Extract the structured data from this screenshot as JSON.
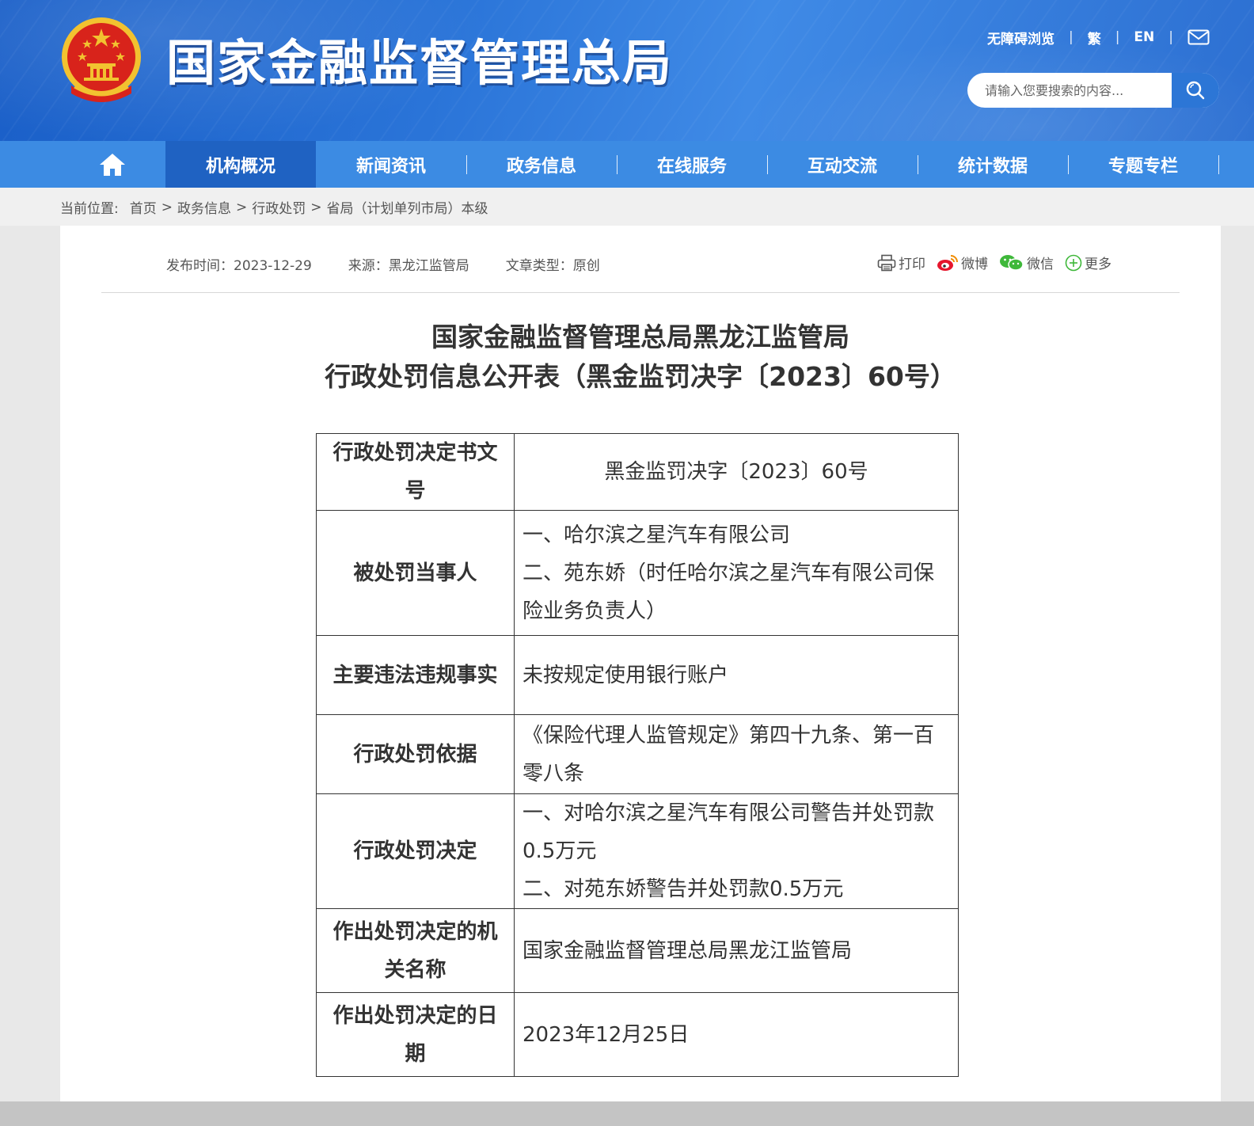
{
  "header": {
    "site_title": "国家金融监督管理总局",
    "top_links": {
      "accessibility": "无障碍浏览",
      "traditional": "繁",
      "english": "EN"
    },
    "search": {
      "placeholder": "请输入您要搜索的内容..."
    }
  },
  "nav": {
    "items": [
      {
        "label": "机构概况"
      },
      {
        "label": "新闻资讯"
      },
      {
        "label": "政务信息"
      },
      {
        "label": "在线服务"
      },
      {
        "label": "互动交流"
      },
      {
        "label": "统计数据"
      },
      {
        "label": "专题专栏"
      }
    ]
  },
  "breadcrumb": {
    "label": "当前位置:",
    "items": [
      "首页",
      "政务信息",
      "行政处罚",
      "省局（计划单列市局）本级"
    ]
  },
  "article": {
    "publish_time": "发布时间：2023-12-29",
    "source": "来源：黑龙江监管局",
    "type": "文章类型：原创",
    "share": {
      "print": "打印",
      "weibo": "微博",
      "wechat": "微信",
      "more": "更多"
    },
    "title_line1": "国家金融监督管理总局黑龙江监管局",
    "title_line2": "行政处罚信息公开表（黑金监罚决字〔2023〕60号）"
  },
  "table": {
    "rows": [
      {
        "key": "行政处罚决定书文号",
        "values": [
          "黑金监罚决字〔2023〕60号"
        ]
      },
      {
        "key": "被处罚当事人",
        "values": [
          "一、哈尔滨之星汽车有限公司",
          "二、苑东娇（时任哈尔滨之星汽车有限公司保险业务负责人）"
        ]
      },
      {
        "key": "主要违法违规事实",
        "values": [
          "未按规定使用银行账户"
        ]
      },
      {
        "key": "行政处罚依据",
        "values": [
          "《保险代理人监管规定》第四十九条、第一百零八条"
        ]
      },
      {
        "key": "行政处罚决定",
        "values": [
          "一、对哈尔滨之星汽车有限公司警告并处罚款0.5万元",
          "二、对苑东娇警告并处罚款0.5万元"
        ]
      },
      {
        "key": "作出处罚决定的机关名称",
        "values": [
          "国家金融监督管理总局黑龙江监管局"
        ]
      },
      {
        "key": "作出处罚决定的日期",
        "values": [
          "2023年12月25日"
        ]
      }
    ]
  },
  "colors": {
    "header_blue": "#2a74d8",
    "nav_blue": "#3c8be3",
    "nav_active": "#1f62c2",
    "emblem_red": "#d8231b",
    "emblem_gold": "#f2c230",
    "wechat_green": "#3fb83a",
    "weibo_red": "#e6162d"
  },
  "icons": [
    "national-emblem",
    "mail-icon",
    "search-icon",
    "home-icon",
    "print-icon",
    "weibo-icon",
    "wechat-icon",
    "plus-circle-icon"
  ]
}
